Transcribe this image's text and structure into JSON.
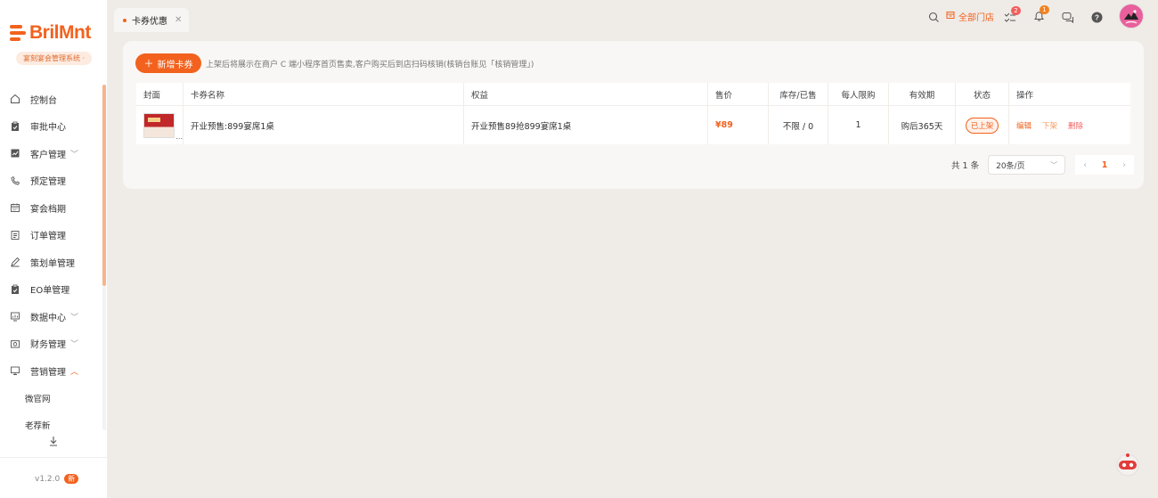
{
  "brand": {
    "logo_text": "BrilMnt",
    "system_tag": "宴刻宴会管理系统 ·",
    "accent_color": "#f2621e"
  },
  "sidebar": {
    "items": [
      {
        "label": "控制台",
        "icon": "home-icon"
      },
      {
        "label": "审批中心",
        "icon": "approval-icon"
      },
      {
        "label": "客户管理",
        "icon": "chart-icon",
        "expandable": true
      },
      {
        "label": "预定管理",
        "icon": "phone-icon"
      },
      {
        "label": "宴会档期",
        "icon": "calendar-icon"
      },
      {
        "label": "订单管理",
        "icon": "document-icon"
      },
      {
        "label": "策划单管理",
        "icon": "pen-icon"
      },
      {
        "label": "EO单管理",
        "icon": "clipboard-icon"
      },
      {
        "label": "数据中心",
        "icon": "data-icon",
        "expandable": true
      },
      {
        "label": "财务管理",
        "icon": "finance-icon",
        "expandable": true
      },
      {
        "label": "营销管理",
        "icon": "monitor-icon",
        "expanded": true
      }
    ],
    "sub_items": [
      "微官网",
      "老荐新"
    ],
    "version": "v1.2.0",
    "new_badge": "新"
  },
  "header": {
    "tab_label": "卡券优惠",
    "store_label": "全部门店",
    "task_badge": "2",
    "notice_badge": "1"
  },
  "toolbar": {
    "add_button": "新增卡券",
    "hint": "上架后将展示在商户 C 端小程序首页售卖,客户购买后到店扫码核销(核销台账见「核销管理」)"
  },
  "table": {
    "columns": [
      "封面",
      "卡券名称",
      "权益",
      "售价",
      "库存/已售",
      "每人限购",
      "有效期",
      "状态",
      "操作"
    ],
    "rows": [
      {
        "cover_ellipsis": "...",
        "name": "开业预售:899宴席1桌",
        "benefit": "开业预售89抢899宴席1桌",
        "price": "¥89",
        "stock": "不限 / 0",
        "limit": "1",
        "validity": "购后365天",
        "status": "已上架",
        "actions": {
          "edit": "编辑",
          "off": "下架",
          "delete": "删除"
        }
      }
    ]
  },
  "pagination": {
    "total": "共 1 条",
    "page_size": "20条/页",
    "current": "1"
  }
}
